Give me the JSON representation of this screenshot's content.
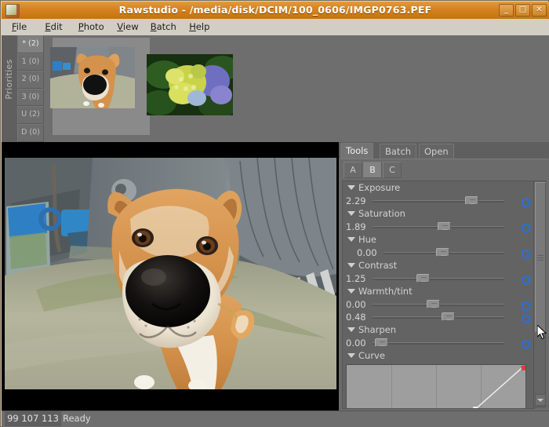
{
  "window": {
    "title": "Rawstudio - /media/disk/DCIM/100_0606/IMGP0763.PEF",
    "app_icon": "rawstudio-icon",
    "buttons": {
      "minimize": "_",
      "maximize": "□",
      "close": "✕"
    },
    "title_bar_color": "#d4821f"
  },
  "menubar": {
    "items": [
      {
        "label": "File",
        "mnemonic": "F"
      },
      {
        "label": "Edit",
        "mnemonic": "E"
      },
      {
        "label": "Photo",
        "mnemonic": "P"
      },
      {
        "label": "View",
        "mnemonic": "V"
      },
      {
        "label": "Batch",
        "mnemonic": "B"
      },
      {
        "label": "Help",
        "mnemonic": "H"
      }
    ]
  },
  "priorities": {
    "label": "Priorities",
    "buttons": [
      {
        "key": "*",
        "count": "(2)",
        "label": "*  (2)",
        "selected": true
      },
      {
        "key": "1",
        "count": "(0)",
        "label": "1  (0)",
        "selected": false
      },
      {
        "key": "2",
        "count": "(0)",
        "label": "2  (0)",
        "selected": false
      },
      {
        "key": "3",
        "count": "(0)",
        "label": "3  (0)",
        "selected": false
      },
      {
        "key": "U",
        "count": "(2)",
        "label": "U  (2)",
        "selected": false
      },
      {
        "key": "D",
        "count": "(0)",
        "label": "D  (0)",
        "selected": false
      }
    ]
  },
  "thumbnails": {
    "items": [
      {
        "name": "thumbnail-dog",
        "subject": "shiba-inu-fisheye-photo",
        "selected": true
      },
      {
        "name": "thumbnail-flower",
        "subject": "hydrangea-flower-photo",
        "selected": false
      }
    ]
  },
  "preview": {
    "name": "main-image-preview",
    "subject": "shiba-inu-fisheye-photo",
    "letterbox_color": "#000000"
  },
  "tools": {
    "tabs": [
      {
        "label": "Tools",
        "active": true
      },
      {
        "label": "Batch",
        "active": false
      },
      {
        "label": "Open",
        "active": false
      }
    ],
    "snapshots": [
      {
        "label": "A",
        "selected": false
      },
      {
        "label": "B",
        "selected": true
      },
      {
        "label": "C",
        "selected": false
      }
    ],
    "sections": [
      {
        "title": "Exposure",
        "expanded": true,
        "sliders": [
          {
            "value": "2.29",
            "pos_pct": 78,
            "indent": false,
            "reset": "reset-icon"
          }
        ]
      },
      {
        "title": "Saturation",
        "expanded": true,
        "sliders": [
          {
            "value": "1.89",
            "pos_pct": 55,
            "indent": false,
            "reset": "reset-icon"
          }
        ]
      },
      {
        "title": "Hue",
        "expanded": true,
        "sliders": [
          {
            "value": "0.00",
            "pos_pct": 49,
            "indent": true,
            "reset": "reset-icon"
          }
        ]
      },
      {
        "title": "Contrast",
        "expanded": true,
        "sliders": [
          {
            "value": "1.25",
            "pos_pct": 37,
            "indent": false,
            "reset": "reset-icon"
          }
        ]
      },
      {
        "title": "Warmth/tint",
        "expanded": true,
        "sliders": [
          {
            "value": "0.00",
            "pos_pct": 46,
            "indent": false,
            "reset": "reset-icon"
          },
          {
            "value": "0.48",
            "pos_pct": 58,
            "indent": false,
            "reset": "reset-icon"
          }
        ]
      },
      {
        "title": "Sharpen",
        "expanded": true,
        "sliders": [
          {
            "value": "0.00",
            "pos_pct": 2,
            "indent": false,
            "reset": "reset-icon"
          }
        ]
      },
      {
        "title": "Curve",
        "expanded": true,
        "sliders": []
      }
    ],
    "curve": {
      "name": "tone-curve-editor",
      "grid_columns": 4,
      "points": [
        {
          "x_pct": 72,
          "y_pct": 97,
          "color": "#ffffff"
        },
        {
          "x_pct": 99,
          "y_pct": 3,
          "color": "#e03c3c"
        }
      ]
    },
    "scrollbar": {
      "name": "tools-scrollbar",
      "thumb_top_pct": 0,
      "thumb_height_pct": 66
    }
  },
  "statusbar": {
    "rgb_readout": "99 107 113",
    "message": "Ready"
  }
}
